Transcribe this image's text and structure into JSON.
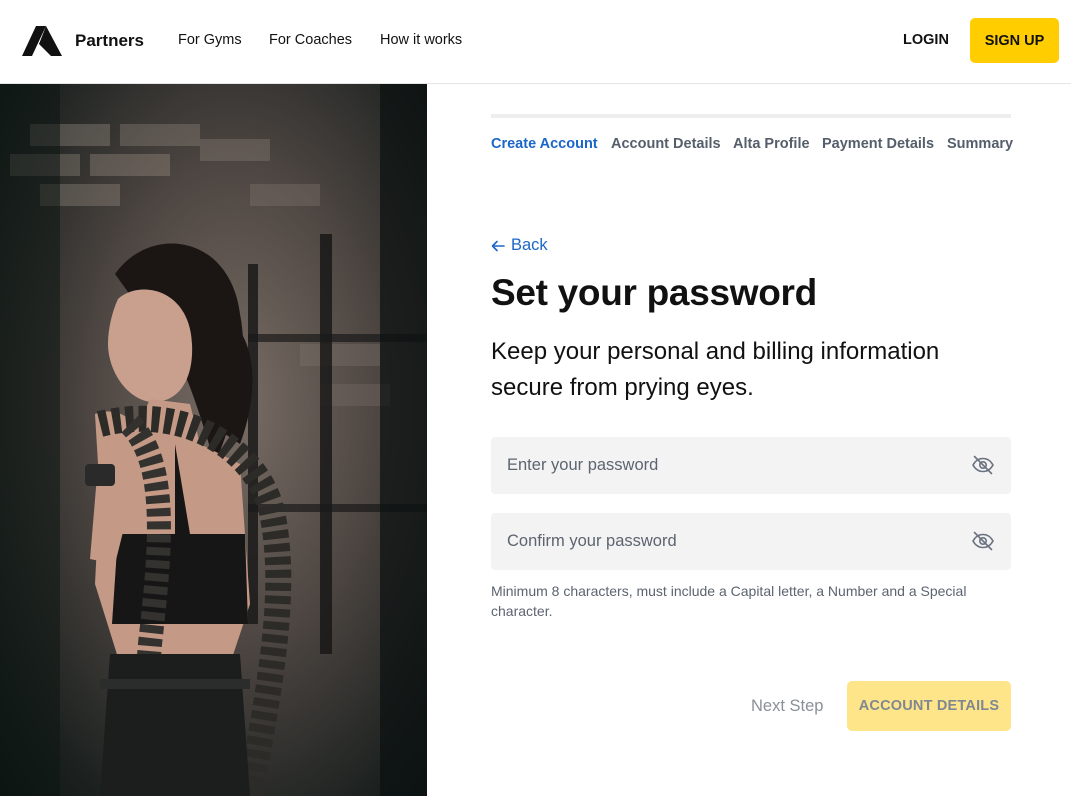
{
  "header": {
    "brand": "Partners",
    "nav": [
      "For Gyms",
      "For Coaches",
      "How it works"
    ],
    "login_label": "LOGIN",
    "signup_label": "SIGN UP"
  },
  "steps": [
    "Create Account",
    "Account Details",
    "Alta Profile",
    "Payment Details",
    "Summary"
  ],
  "active_step": "Create Account",
  "form": {
    "back_label": "Back",
    "title": "Set your password",
    "subtitle": "Keep your personal and billing information secure from prying eyes.",
    "password_placeholder": "Enter your password",
    "confirm_placeholder": "Confirm your password",
    "password_value": "",
    "confirm_value": "",
    "hint": "Minimum 8 characters, must include a Capital letter, a Number and a Special character.",
    "next_step_label": "Next Step",
    "next_button_label": "ACCOUNT DETAILS"
  },
  "icons": {
    "logo": "alta-logo-icon",
    "back": "arrow-left-icon",
    "password_toggle": "eye-off-icon"
  },
  "colors": {
    "accent_yellow": "#ffcd00",
    "disabled_yellow": "#ffe58a",
    "link_blue": "#1b66c9",
    "field_bg": "#f3f3f4"
  }
}
